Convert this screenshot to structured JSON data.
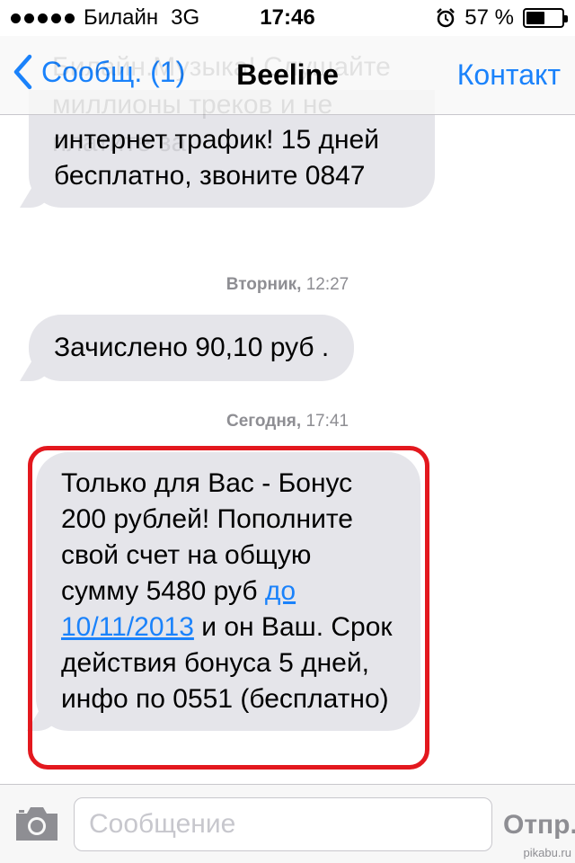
{
  "status_bar": {
    "carrier": "Билайн",
    "network": "3G",
    "time": "17:46",
    "battery_percent": "57 %",
    "battery_level": 0.57,
    "icons": [
      "signal-dots-icon",
      "alarm-clock-icon",
      "battery-icon"
    ]
  },
  "nav": {
    "back_label": "Сообщ. (1)",
    "title": "Beeline",
    "contact_label": "Контакт",
    "ghost_text": "Билайн.Музыка! Слушайте миллионы треков и не платите за"
  },
  "messages": [
    {
      "text": "интернет трафик! 15 дней бесплатно, звоните 0847"
    },
    {
      "timestamp_day": "Вторник,",
      "timestamp_time": "12:27",
      "text": "Зачислено 90,10 руб ."
    },
    {
      "timestamp_day": "Сегодня,",
      "timestamp_time": "17:41",
      "text_before_link": "Только для Вас - Бонус 200 рублей! Пополните свой счет на общую сумму 5480 руб ",
      "link_text": "до 10/11/2013",
      "text_after_link": " и он Ваш. Срок действия бонуса 5 дней, инфо по 0551 (бесплатно)"
    }
  ],
  "input_bar": {
    "placeholder": "Сообщение",
    "value": "",
    "send_label": "Отпр."
  },
  "watermark": "pikabu.ru",
  "colors": {
    "accent": "#1a82fb",
    "bubble": "#e5e5ea",
    "highlight": "#e3181e"
  }
}
